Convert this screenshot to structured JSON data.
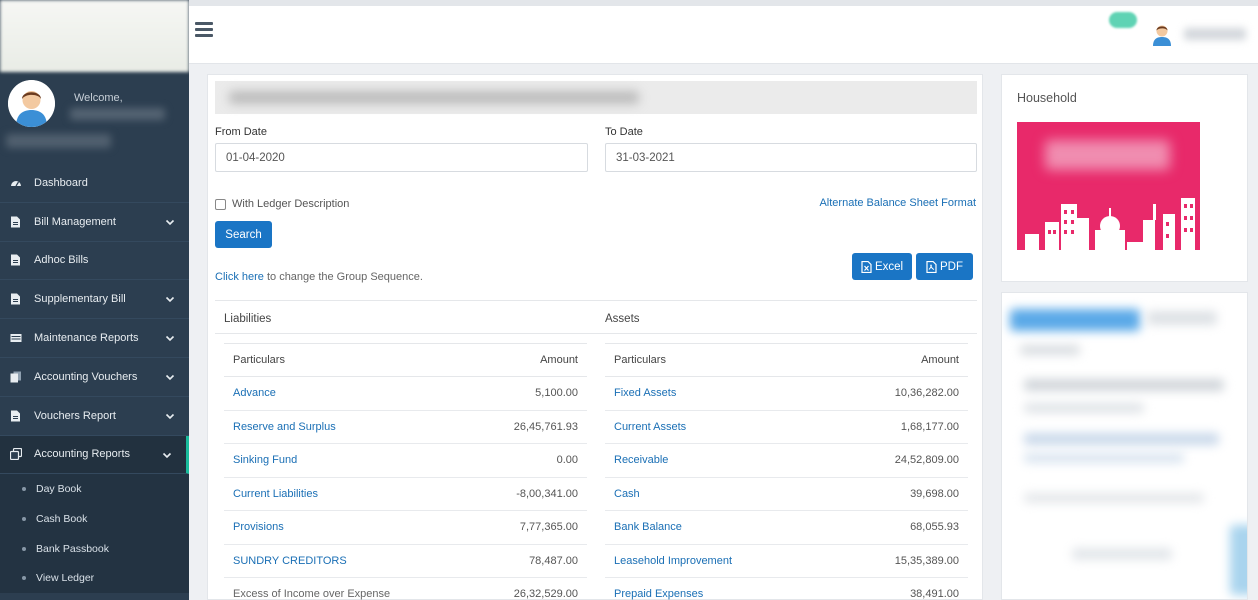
{
  "sidebar": {
    "welcome": "Welcome,",
    "menu": [
      {
        "label": "Dashboard",
        "icon": "dashboard-icon"
      },
      {
        "label": "Bill Management",
        "icon": "file-icon",
        "expandable": true
      },
      {
        "label": "Adhoc Bills",
        "icon": "file-icon"
      },
      {
        "label": "Supplementary Bill",
        "icon": "file-icon",
        "expandable": true
      },
      {
        "label": "Maintenance Reports",
        "icon": "table-icon",
        "expandable": true
      },
      {
        "label": "Accounting Vouchers",
        "icon": "files-icon",
        "expandable": true
      },
      {
        "label": "Vouchers Report",
        "icon": "file-icon",
        "expandable": true
      },
      {
        "label": "Accounting Reports",
        "icon": "copy-icon",
        "expandable": true,
        "active": true
      }
    ],
    "submenu": [
      "Day Book",
      "Cash Book",
      "Bank Passbook",
      "View Ledger"
    ]
  },
  "form": {
    "from_label": "From Date",
    "from_value": "01-04-2020",
    "to_label": "To Date",
    "to_value": "31-03-2021",
    "checkbox_label": "With Ledger Description",
    "alt_link": "Alternate Balance Sheet Format",
    "search_button": "Search",
    "click_here": "Click here",
    "click_rest": " to change the Group Sequence.",
    "excel_button": "Excel",
    "pdf_button": "PDF"
  },
  "liabilities": {
    "title": "Liabilities",
    "col_particulars": "Particulars",
    "col_amount": "Amount",
    "rows": [
      {
        "name": "Advance",
        "amount": "5,100.00"
      },
      {
        "name": "Reserve and Surplus",
        "amount": "26,45,761.93"
      },
      {
        "name": "Sinking Fund",
        "amount": "0.00"
      },
      {
        "name": "Current Liabilities",
        "amount": "-8,00,341.00"
      },
      {
        "name": "Provisions",
        "amount": "7,77,365.00"
      },
      {
        "name": "SUNDRY CREDITORS",
        "amount": "78,487.00"
      },
      {
        "name": "Excess of Income over Expense",
        "amount": "26,32,529.00"
      }
    ]
  },
  "assets": {
    "title": "Assets",
    "col_particulars": "Particulars",
    "col_amount": "Amount",
    "rows": [
      {
        "name": "Fixed Assets",
        "amount": "10,36,282.00"
      },
      {
        "name": "Current Assets",
        "amount": "1,68,177.00"
      },
      {
        "name": "Receivable",
        "amount": "24,52,809.00"
      },
      {
        "name": "Cash",
        "amount": "39,698.00"
      },
      {
        "name": "Bank Balance",
        "amount": "68,055.93"
      },
      {
        "name": "Leasehold Improvement",
        "amount": "15,35,389.00"
      },
      {
        "name": "Prepaid Expenses",
        "amount": "38,491.00"
      }
    ]
  },
  "right_panel": {
    "household_title": "Household"
  },
  "colors": {
    "sidebar_bg": "#2c3e50",
    "accent": "#1a75c5",
    "active_marker": "#1abc9c",
    "banner": "#e8296a"
  }
}
